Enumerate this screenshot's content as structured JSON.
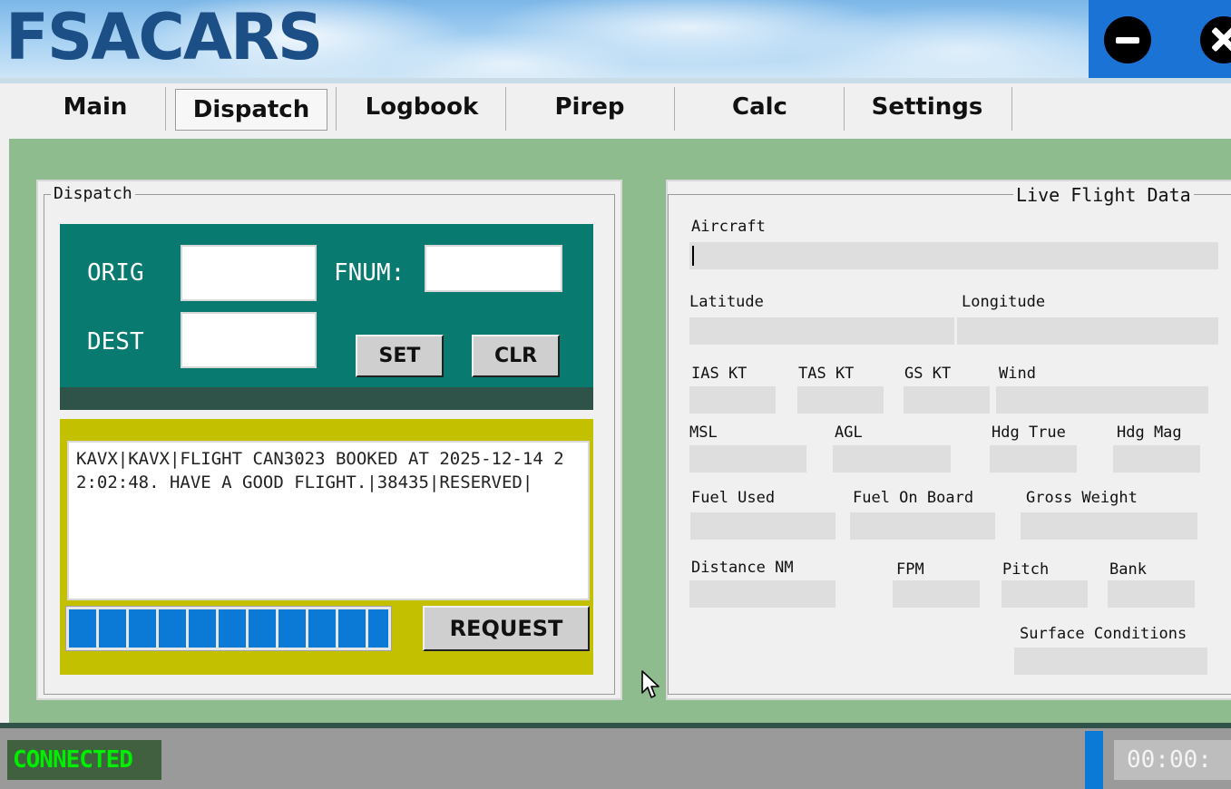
{
  "app": {
    "title": "FSACARS"
  },
  "tabs": [
    {
      "label": "Main"
    },
    {
      "label": "Dispatch",
      "active": true
    },
    {
      "label": "Logbook"
    },
    {
      "label": "Pirep"
    },
    {
      "label": "Calc"
    },
    {
      "label": "Settings"
    }
  ],
  "dispatch": {
    "legend": "Dispatch",
    "orig_label": "ORIG",
    "fnum_label": "FNUM:",
    "dest_label": "DEST",
    "orig_value": "",
    "fnum_value": "",
    "dest_value": "",
    "set_label": "SET",
    "clr_label": "CLR",
    "message": "KAVX|KAVX|FLIGHT CAN3023 BOOKED AT 2025-12-14 22:02:48. HAVE A GOOD FLIGHT.|38435|RESERVED|",
    "progress_percent": 100,
    "request_label": "REQUEST"
  },
  "live": {
    "legend": "Live Flight Data",
    "aircraft": "Aircraft",
    "latitude": "Latitude",
    "longitude": "Longitude",
    "ias": "IAS KT",
    "tas": "TAS KT",
    "gs": "GS KT",
    "wind": "Wind",
    "msl": "MSL",
    "agl": "AGL",
    "hdg_true": "Hdg True",
    "hdg_mag": "Hdg Mag",
    "fuel_used": "Fuel Used",
    "fuel_on_board": "Fuel On Board",
    "gross_weight": "Gross Weight",
    "distance": "Distance NM",
    "fpm": "FPM",
    "pitch": "Pitch",
    "bank": "Bank",
    "surface": "Surface Conditions"
  },
  "status": {
    "connection": "CONNECTED",
    "time": "00:00:"
  },
  "icons": {
    "minimize": "minimize-icon",
    "close": "close-icon",
    "cursor": "mouse-cursor-icon"
  },
  "colors": {
    "logo": "#1d4f87",
    "green_bg": "#8fbc8f",
    "teal_panel": "#087a6f",
    "olive_panel": "#c3c000",
    "progress_fill": "#0a7ad6",
    "connected_text": "#00ee00"
  }
}
